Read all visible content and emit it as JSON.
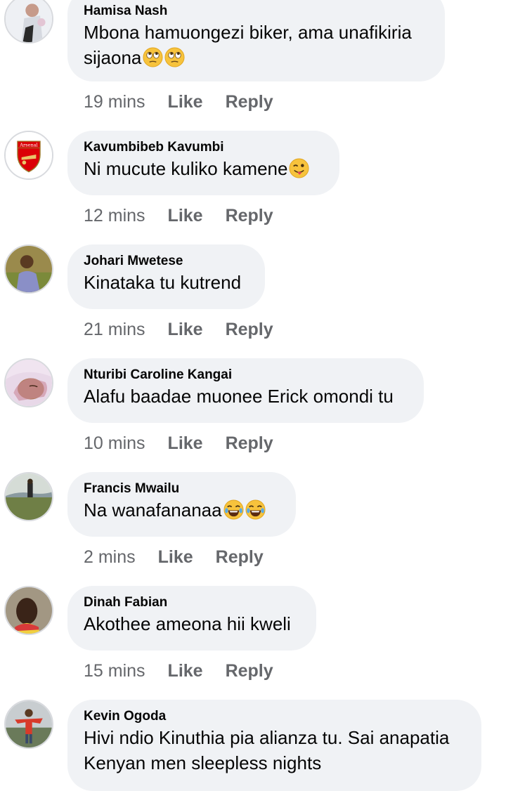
{
  "comments": [
    {
      "author": "Hamisa Nash",
      "text_lines": [
        "Mbona hamuongezi biker, ama unafikiria",
        "sijaona"
      ],
      "emojis": [
        "rolling-eyes",
        "rolling-eyes"
      ],
      "time": "19 mins",
      "like": "Like",
      "reply": "Reply"
    },
    {
      "author": "Kavumbibeb Kavumbi",
      "text_lines": [
        "Ni mucute kuliko kamene"
      ],
      "emojis": [
        "winking-tongue"
      ],
      "time": "12 mins",
      "like": "Like",
      "reply": "Reply",
      "avatar_badge": "Arsenal"
    },
    {
      "author": "Johari Mwetese",
      "text_lines": [
        "Kinataka tu kutrend"
      ],
      "emojis": [],
      "time": "21 mins",
      "like": "Like",
      "reply": "Reply"
    },
    {
      "author": "Nturibi Caroline Kangai",
      "text_lines": [
        "Alafu baadae muonee Erick omondi tu"
      ],
      "emojis": [],
      "time": "10 mins",
      "like": "Like",
      "reply": "Reply"
    },
    {
      "author": "Francis Mwailu",
      "text_lines": [
        "Na wanafananaa"
      ],
      "emojis": [
        "tears-of-joy",
        "tears-of-joy"
      ],
      "time": "2 mins",
      "like": "Like",
      "reply": "Reply"
    },
    {
      "author": "Dinah Fabian",
      "text_lines": [
        "Akothee ameona hii kweli"
      ],
      "emojis": [],
      "time": "15 mins",
      "like": "Like",
      "reply": "Reply"
    },
    {
      "author": "Kevin Ogoda",
      "text_lines": [
        "Hivi ndio Kinuthia pia alianza tu. Sai anapatia",
        "Kenyan men sleepless nights"
      ],
      "emojis": [],
      "time": "",
      "like": "",
      "reply": ""
    }
  ],
  "colors": {
    "bubble": "#f0f2f5",
    "meta_text": "#65676b",
    "text": "#050505"
  }
}
